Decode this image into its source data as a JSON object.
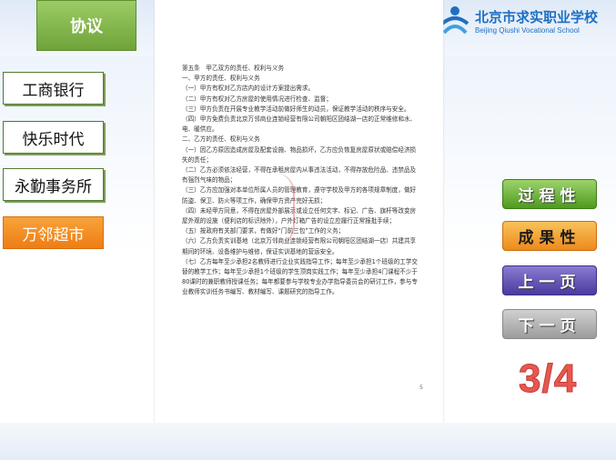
{
  "header": {
    "tab_label": "协议"
  },
  "logo": {
    "name_cn": "北京市求实职业学校",
    "name_en": "Beijing Qiushi Vocational School"
  },
  "nav": {
    "items": [
      {
        "label": "工商银行"
      },
      {
        "label": "快乐时代"
      },
      {
        "label": "永勤事务所"
      },
      {
        "label": "万邻超市"
      }
    ]
  },
  "document": {
    "lines": [
      "第五条　甲乙双方的责任、权利与义务",
      "一、甲方的责任、权利与义务",
      "（一）甲方有权对乙方店内的设计方案提出需求。",
      "（二）甲方有权对乙方房屋的使用情况进行检查、监督；",
      "（三）甲方负责在开展专业教学活动前做好师生的动员，保证教学活动的秩序与安全。",
      "（四）甲方免费负责北京万邻商业连锁经营有限公司朝阳区团结湖一店的正常维修和水、电、暖供应。",
      "二、乙方的责任、权利与义务",
      "（一）因乙方原因造成房屋及配套设施、物品损坏，乙方应负恢复房屋原状或赔偿经济损失的责任；",
      "（二）乙方必须依法经营，不得在承租房屋内从事违法活动，不得存放危险品、违禁品及有强烈气味的物品；",
      "（三）乙方应加强对本单位所属人员的管理教育，遵守学校及甲方的各项规章制度，做好防盗、保卫、防火等项工作，确保甲方资产完好无损；",
      "（四）未经甲方同意，不得在房屋外部展示或设立任何文字、标记、广告、旗杆等改变房屋外观的设施（便利店的标识除外），户外灯箱广告的设立应履行正常报批手续；",
      "（五）按政府有关部门要求，有做好“门前三包”工作的义务；",
      "（六）乙方负责实训基地（北京万邻商业连锁经营有限公司朝阳区团结湖一店）共建共享期间的环境、设备维护与维修，保证实训基地的营运安全。",
      "（七）乙方每年至少承担2名教师进行企业实践指导工作；每年至少承担1个班级的工学交替的教学工作；每年至少承担1个班级的学生顶岗实践工作；每年至少承担4门课程不少于80课时的兼职教师授课任务；每年都要参与学校专业办学指导委员会的研讨工作，参与专业教师实训任务书编写、教材编写、课题研究的指导工作。"
    ],
    "page_number": "5"
  },
  "side_buttons": {
    "process": "过程性",
    "result": "成果性",
    "prev": "上一页",
    "next": "下一页"
  },
  "pager": {
    "text": "3/4"
  },
  "colors": {
    "green": "#6fa33a",
    "orange": "#ee7d14",
    "purple": "#4b3a9e",
    "pager_red": "#e8574f"
  }
}
